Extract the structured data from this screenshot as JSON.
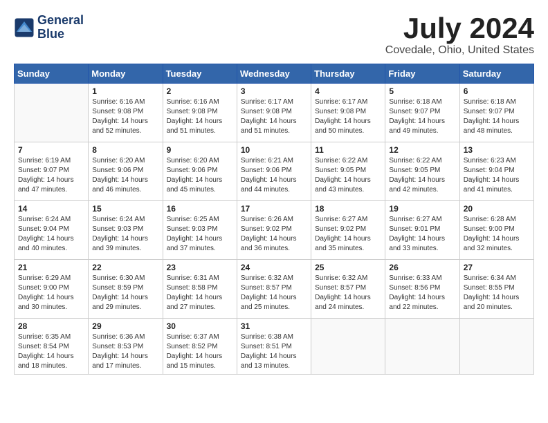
{
  "logo": {
    "line1": "General",
    "line2": "Blue"
  },
  "title": "July 2024",
  "subtitle": "Covedale, Ohio, United States",
  "days_of_week": [
    "Sunday",
    "Monday",
    "Tuesday",
    "Wednesday",
    "Thursday",
    "Friday",
    "Saturday"
  ],
  "weeks": [
    [
      {
        "day": "",
        "content": ""
      },
      {
        "day": "1",
        "content": "Sunrise: 6:16 AM\nSunset: 9:08 PM\nDaylight: 14 hours\nand 52 minutes."
      },
      {
        "day": "2",
        "content": "Sunrise: 6:16 AM\nSunset: 9:08 PM\nDaylight: 14 hours\nand 51 minutes."
      },
      {
        "day": "3",
        "content": "Sunrise: 6:17 AM\nSunset: 9:08 PM\nDaylight: 14 hours\nand 51 minutes."
      },
      {
        "day": "4",
        "content": "Sunrise: 6:17 AM\nSunset: 9:08 PM\nDaylight: 14 hours\nand 50 minutes."
      },
      {
        "day": "5",
        "content": "Sunrise: 6:18 AM\nSunset: 9:07 PM\nDaylight: 14 hours\nand 49 minutes."
      },
      {
        "day": "6",
        "content": "Sunrise: 6:18 AM\nSunset: 9:07 PM\nDaylight: 14 hours\nand 48 minutes."
      }
    ],
    [
      {
        "day": "7",
        "content": "Sunrise: 6:19 AM\nSunset: 9:07 PM\nDaylight: 14 hours\nand 47 minutes."
      },
      {
        "day": "8",
        "content": "Sunrise: 6:20 AM\nSunset: 9:06 PM\nDaylight: 14 hours\nand 46 minutes."
      },
      {
        "day": "9",
        "content": "Sunrise: 6:20 AM\nSunset: 9:06 PM\nDaylight: 14 hours\nand 45 minutes."
      },
      {
        "day": "10",
        "content": "Sunrise: 6:21 AM\nSunset: 9:06 PM\nDaylight: 14 hours\nand 44 minutes."
      },
      {
        "day": "11",
        "content": "Sunrise: 6:22 AM\nSunset: 9:05 PM\nDaylight: 14 hours\nand 43 minutes."
      },
      {
        "day": "12",
        "content": "Sunrise: 6:22 AM\nSunset: 9:05 PM\nDaylight: 14 hours\nand 42 minutes."
      },
      {
        "day": "13",
        "content": "Sunrise: 6:23 AM\nSunset: 9:04 PM\nDaylight: 14 hours\nand 41 minutes."
      }
    ],
    [
      {
        "day": "14",
        "content": "Sunrise: 6:24 AM\nSunset: 9:04 PM\nDaylight: 14 hours\nand 40 minutes."
      },
      {
        "day": "15",
        "content": "Sunrise: 6:24 AM\nSunset: 9:03 PM\nDaylight: 14 hours\nand 39 minutes."
      },
      {
        "day": "16",
        "content": "Sunrise: 6:25 AM\nSunset: 9:03 PM\nDaylight: 14 hours\nand 37 minutes."
      },
      {
        "day": "17",
        "content": "Sunrise: 6:26 AM\nSunset: 9:02 PM\nDaylight: 14 hours\nand 36 minutes."
      },
      {
        "day": "18",
        "content": "Sunrise: 6:27 AM\nSunset: 9:02 PM\nDaylight: 14 hours\nand 35 minutes."
      },
      {
        "day": "19",
        "content": "Sunrise: 6:27 AM\nSunset: 9:01 PM\nDaylight: 14 hours\nand 33 minutes."
      },
      {
        "day": "20",
        "content": "Sunrise: 6:28 AM\nSunset: 9:00 PM\nDaylight: 14 hours\nand 32 minutes."
      }
    ],
    [
      {
        "day": "21",
        "content": "Sunrise: 6:29 AM\nSunset: 9:00 PM\nDaylight: 14 hours\nand 30 minutes."
      },
      {
        "day": "22",
        "content": "Sunrise: 6:30 AM\nSunset: 8:59 PM\nDaylight: 14 hours\nand 29 minutes."
      },
      {
        "day": "23",
        "content": "Sunrise: 6:31 AM\nSunset: 8:58 PM\nDaylight: 14 hours\nand 27 minutes."
      },
      {
        "day": "24",
        "content": "Sunrise: 6:32 AM\nSunset: 8:57 PM\nDaylight: 14 hours\nand 25 minutes."
      },
      {
        "day": "25",
        "content": "Sunrise: 6:32 AM\nSunset: 8:57 PM\nDaylight: 14 hours\nand 24 minutes."
      },
      {
        "day": "26",
        "content": "Sunrise: 6:33 AM\nSunset: 8:56 PM\nDaylight: 14 hours\nand 22 minutes."
      },
      {
        "day": "27",
        "content": "Sunrise: 6:34 AM\nSunset: 8:55 PM\nDaylight: 14 hours\nand 20 minutes."
      }
    ],
    [
      {
        "day": "28",
        "content": "Sunrise: 6:35 AM\nSunset: 8:54 PM\nDaylight: 14 hours\nand 18 minutes."
      },
      {
        "day": "29",
        "content": "Sunrise: 6:36 AM\nSunset: 8:53 PM\nDaylight: 14 hours\nand 17 minutes."
      },
      {
        "day": "30",
        "content": "Sunrise: 6:37 AM\nSunset: 8:52 PM\nDaylight: 14 hours\nand 15 minutes."
      },
      {
        "day": "31",
        "content": "Sunrise: 6:38 AM\nSunset: 8:51 PM\nDaylight: 14 hours\nand 13 minutes."
      },
      {
        "day": "",
        "content": ""
      },
      {
        "day": "",
        "content": ""
      },
      {
        "day": "",
        "content": ""
      }
    ]
  ]
}
